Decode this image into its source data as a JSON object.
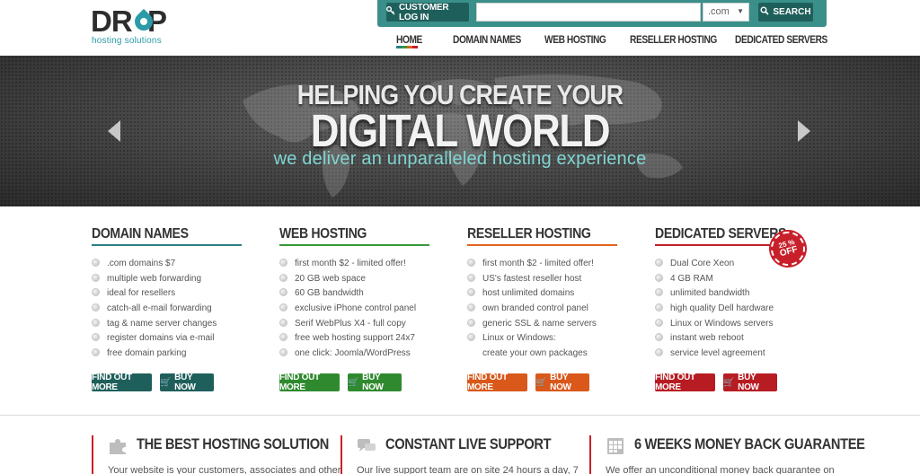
{
  "header": {
    "logo_word": "DROP",
    "logo_sub": "hosting solutions",
    "login_label": "CUSTOMER LOG IN",
    "domain_value": "",
    "domain_placeholder": "",
    "tld_selected": ".com",
    "search_label": "SEARCH"
  },
  "nav": [
    {
      "label": "HOME"
    },
    {
      "label": "DOMAIN NAMES"
    },
    {
      "label": "WEB HOSTING"
    },
    {
      "label": "RESELLER HOSTING"
    },
    {
      "label": "DEDICATED SERVERS"
    }
  ],
  "hero": {
    "title_line1": "HELPING YOU CREATE YOUR",
    "title_line2": "DIGITAL WORLD",
    "subtitle": "we deliver an unparalleled hosting experience"
  },
  "columns": [
    {
      "title": "DOMAIN NAMES",
      "color": "#2a7f86",
      "items": [
        ".com domains $7",
        "multiple web forwarding",
        "ideal for resellers",
        "catch-all e-mail forwarding",
        "tag & name server changes",
        "register domains via e-mail",
        "free domain parking"
      ],
      "more_label": "FIND OUT MORE",
      "buy_label": "BUY NOW"
    },
    {
      "title": "WEB HOSTING",
      "color": "#3a9a3a",
      "items": [
        "first month $2 - limited offer!",
        "20 GB web space",
        "60 GB bandwidth",
        "exclusive iPhone control panel",
        "Serif WebPlus X4 - full copy",
        "free web hosting support 24x7",
        "one click: Joomla/WordPress"
      ],
      "more_label": "FIND OUT MORE",
      "buy_label": "BUY NOW"
    },
    {
      "title": "RESELLER HOSTING",
      "color": "#e0621f",
      "items": [
        "first month $2 - limited offer!",
        "US's fastest reseller host",
        "host unlimited domains",
        "own branded control panel",
        "generic SSL & name servers",
        "Linux or Windows:",
        "create your own packages"
      ],
      "more_label": "FIND OUT MORE",
      "buy_label": "BUY NOW"
    },
    {
      "title": "DEDICATED SERVERS",
      "color": "#c21f26",
      "items": [
        "Dual Core Xeon",
        "4 GB RAM",
        "unlimited bandwidth",
        "high quality Dell hardware",
        "Linux or Windows servers",
        "instant web reboot",
        "service level agreement"
      ],
      "more_label": "FIND OUT MORE",
      "buy_label": "BUY NOW"
    }
  ],
  "badge": {
    "line1": "25 %",
    "line2": "OFF"
  },
  "features": [
    {
      "icon": "puzzle-icon",
      "title": "THE BEST HOSTING SOLUTION",
      "text": "Your website is your customers, associates and other"
    },
    {
      "icon": "chat-icon",
      "title": "CONSTANT LIVE SUPPORT",
      "text": "Our live support team are on site 24 hours a day, 7"
    },
    {
      "icon": "calendar-icon",
      "title": "6 WEEKS MONEY BACK GUARANTEE",
      "text": "We offer an unconditional money back guarantee on"
    }
  ],
  "colors": {
    "teal": "#3a8f8a",
    "teal_dark": "#1f5f5b",
    "accent_red": "#c8202a"
  }
}
